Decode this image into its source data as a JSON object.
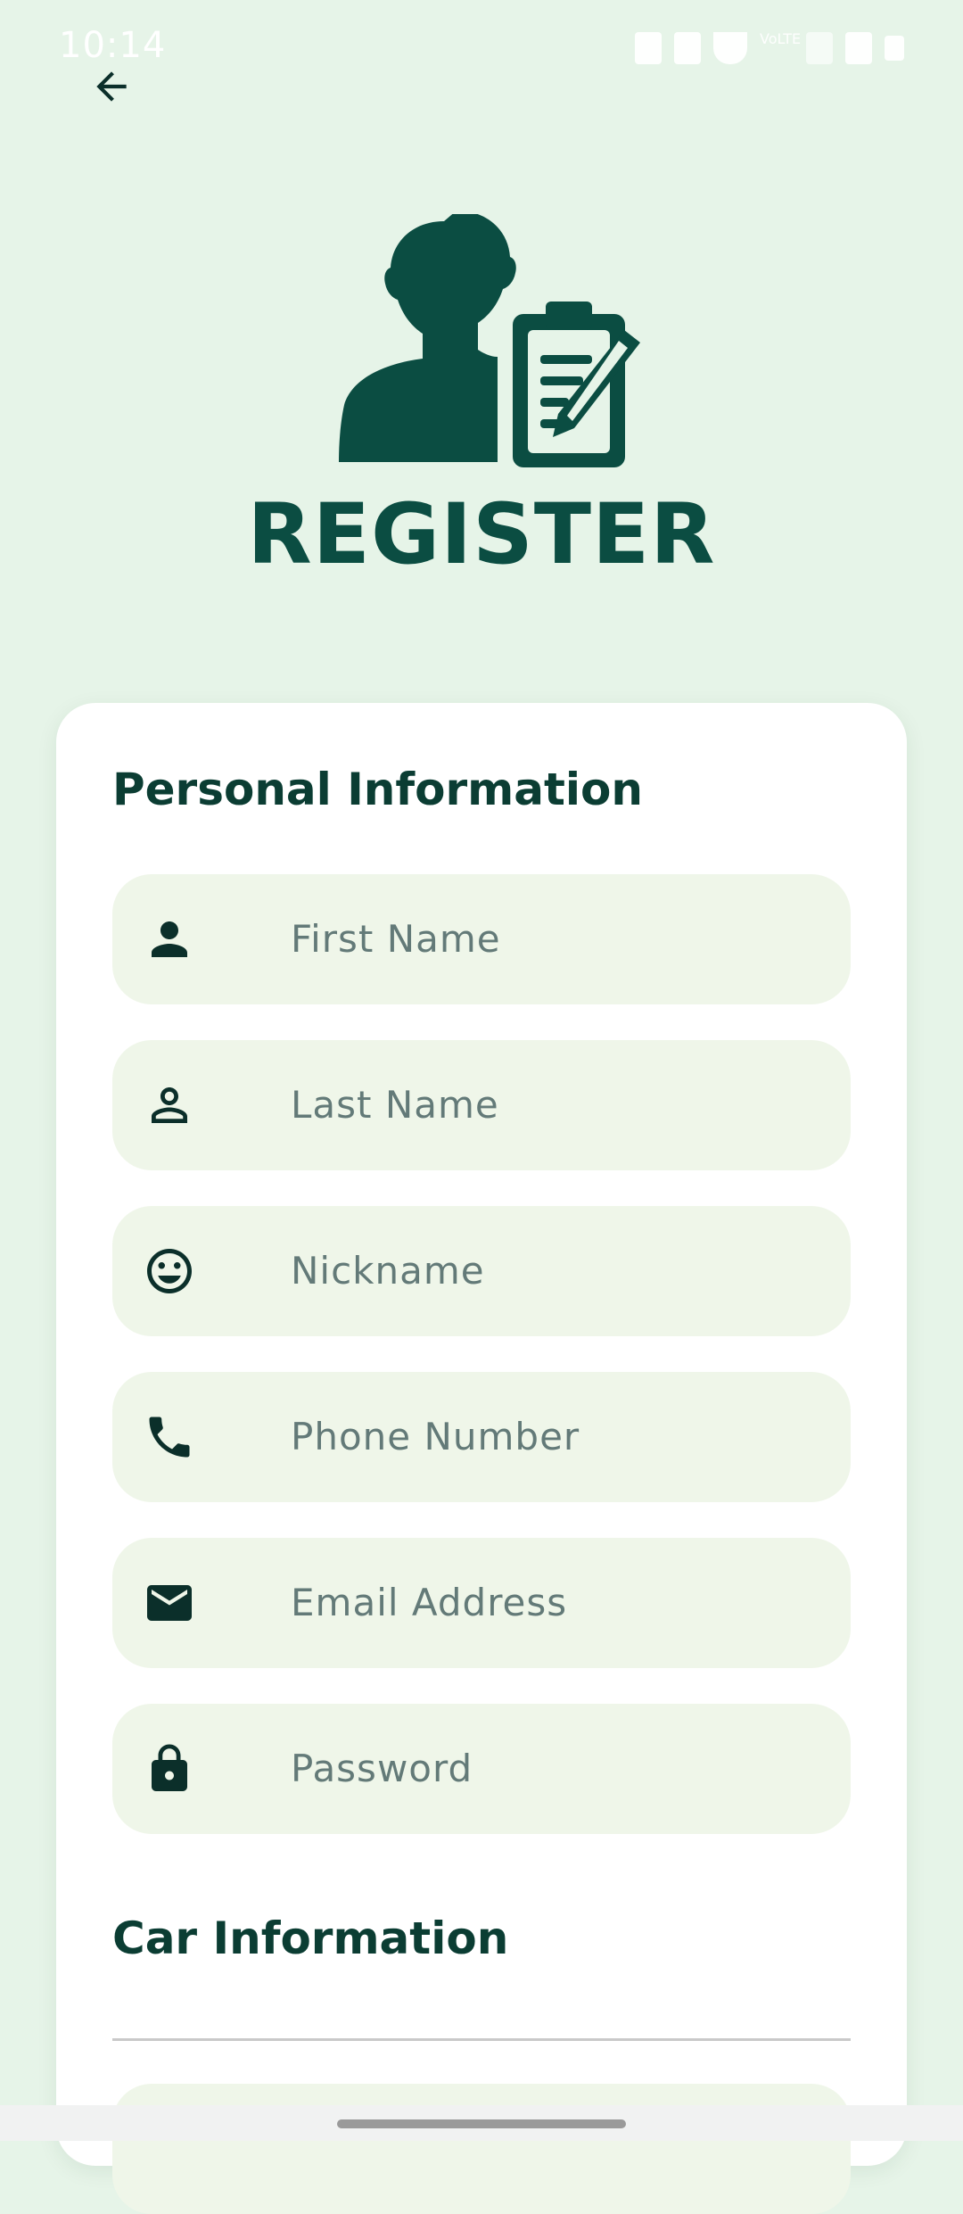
{
  "status_bar": {
    "time": "10:14",
    "network_label": "VoLTE"
  },
  "header": {
    "back_icon": "arrow-left-icon"
  },
  "hero": {
    "illustration": "person-clipboard-icon",
    "title": "REGISTER",
    "color": "#0b4d42"
  },
  "personal": {
    "title": "Personal Information",
    "fields": [
      {
        "icon": "person-icon",
        "placeholder": "First Name"
      },
      {
        "icon": "person-outline-icon",
        "placeholder": "Last Name"
      },
      {
        "icon": "smiley-icon",
        "placeholder": "Nickname"
      },
      {
        "icon": "phone-icon",
        "placeholder": "Phone Number"
      },
      {
        "icon": "mail-icon",
        "placeholder": "Email Address"
      },
      {
        "icon": "lock-icon",
        "placeholder": "Password"
      }
    ]
  },
  "car": {
    "title": "Car Information"
  },
  "colors": {
    "background": "#e6f4e8",
    "field_bg": "#eff6e9",
    "accent": "#0b4d42",
    "placeholder": "#637a78"
  }
}
